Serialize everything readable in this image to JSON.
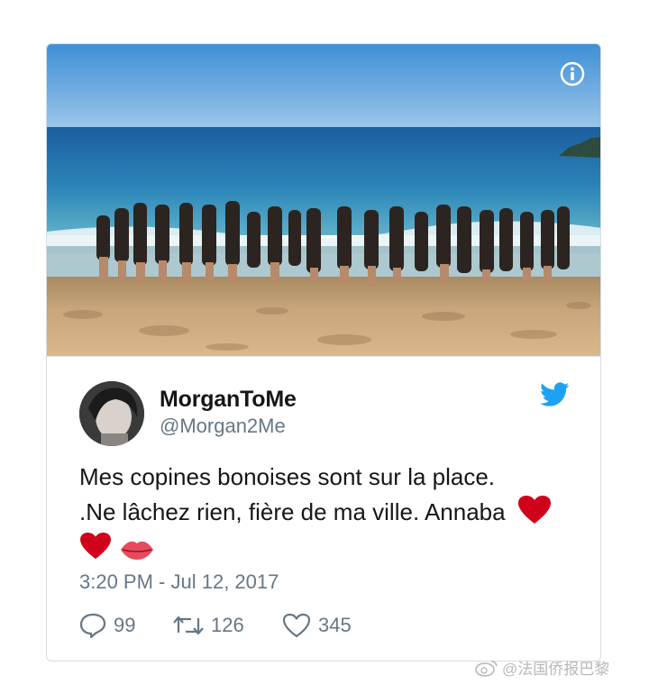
{
  "tweet": {
    "display_name": "MorganToMe",
    "handle": "@Morgan2Me",
    "text_line_1": "Mes copines bonoises sont sur la place.",
    "text_line_2": ".Ne lâchez rien, fière de ma ville. Annaba",
    "timestamp": "3:20 PM - Jul 12, 2017"
  },
  "icons": {
    "info": "info-icon",
    "brand": "twitter-bird-icon",
    "reply": "reply-icon",
    "retweet": "retweet-icon",
    "like": "heart-icon",
    "emoji_heart": "red-heart-emoji",
    "emoji_lips": "lips-emoji"
  },
  "actions": {
    "replies": "99",
    "retweets": "126",
    "likes": "345"
  },
  "watermark": {
    "text": "@法国侨报巴黎"
  },
  "colors": {
    "twitter_blue": "#1da1f2",
    "secondary_text": "#657786",
    "primary_text": "#14171a",
    "border": "#d7dee4",
    "heart_red": "#d0021b"
  }
}
